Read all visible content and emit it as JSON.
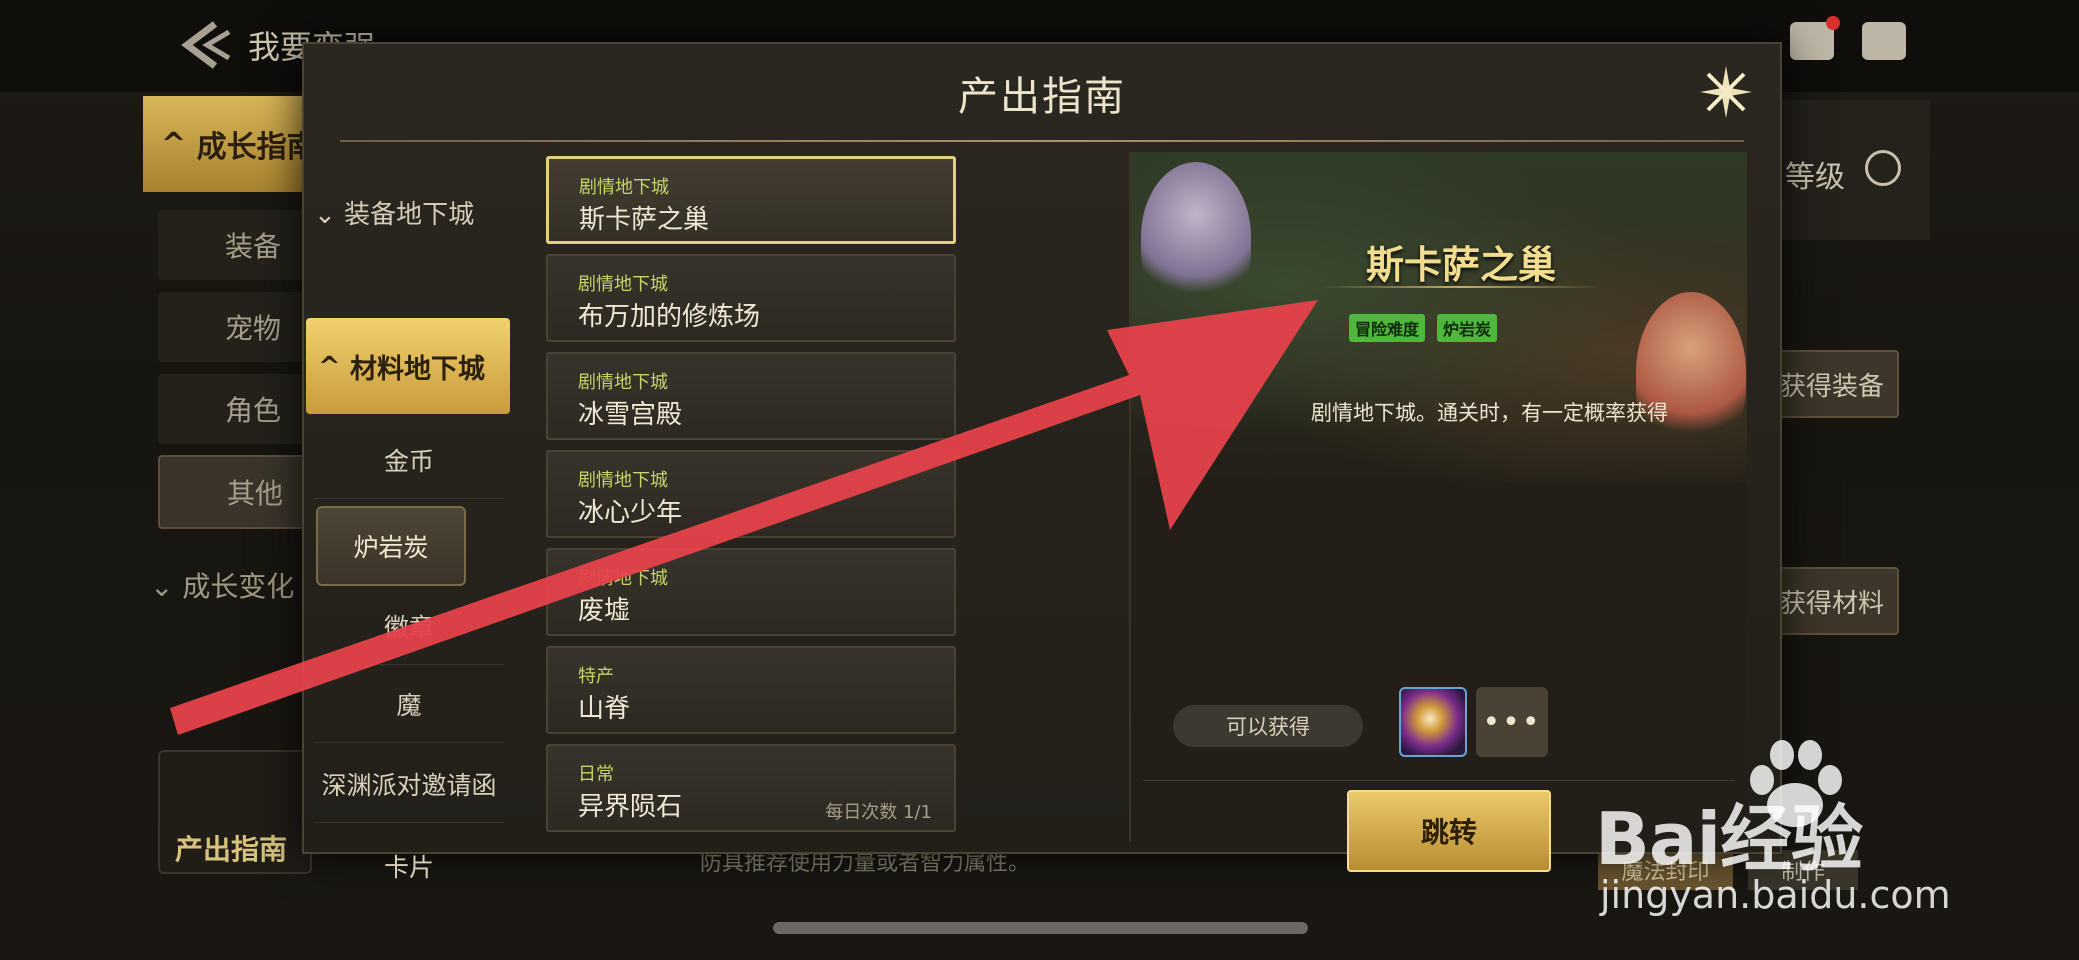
{
  "header": {
    "title": "我要变强",
    "right_icons": [
      "mail-icon",
      "chat-icon"
    ]
  },
  "background": {
    "left_menu": {
      "active": "成长指南",
      "items": [
        "装备",
        "宠物",
        "角色",
        "其他"
      ],
      "selected_item": "其他",
      "collapsed": "成长变化"
    },
    "guide_shortcut": "产出指南",
    "right_panel": {
      "level_label": "等级",
      "btn_equipment": "获得装备",
      "btn_material": "获得材料"
    },
    "bottom_text": "防具推荐使用力量或者智力属性。",
    "btn_magic_seal": "魔法封印",
    "btn_make": "制作"
  },
  "modal": {
    "title": "产出指南",
    "categories": {
      "equip_dungeon": "装备地下城",
      "material_dungeon": "材料地下城",
      "sub_items": [
        "金币",
        "炉岩炭",
        "徽章",
        "魔",
        "深渊派对邀请函",
        "卡片"
      ],
      "selected_sub": "炉岩炭"
    },
    "dungeons": [
      {
        "type": "剧情地下城",
        "name": "斯卡萨之巢"
      },
      {
        "type": "剧情地下城",
        "name": "布万加的修炼场"
      },
      {
        "type": "剧情地下城",
        "name": "冰雪宫殿"
      },
      {
        "type": "剧情地下城",
        "name": "冰心少年"
      },
      {
        "type": "剧情地下城",
        "name": "废墟"
      },
      {
        "type": "特产",
        "name": "山脊"
      },
      {
        "type": "日常",
        "name": "异界陨石",
        "extra": "每日次数 1/1"
      }
    ],
    "detail": {
      "name": "斯卡萨之巢",
      "tags": [
        "冒险难度",
        "炉岩炭"
      ],
      "description": "剧情地下城。通关时，有一定概率获得",
      "obtain_label": "可以获得",
      "more": "•••",
      "jump_button": "跳转"
    }
  },
  "colors": {
    "accent_gold": "#e4cf7f",
    "tag_green": "#4fb73c",
    "arrow_red": "#e5424a"
  },
  "watermark": {
    "brand": "Bai经验",
    "site": "jingyan.baidu.com"
  }
}
